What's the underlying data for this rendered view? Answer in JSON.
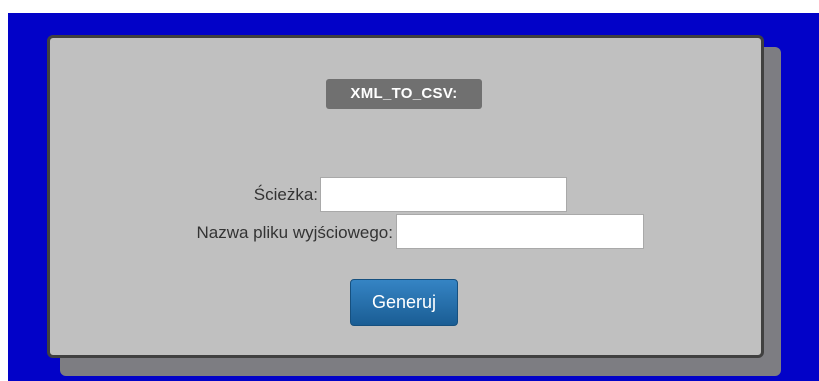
{
  "form": {
    "title": "XML_TO_CSV:",
    "path_label": "Ścieżka:",
    "path_value": "",
    "output_label": "Nazwa pliku wyjściowego:",
    "output_value": "",
    "submit_label": "Generuj"
  },
  "colors": {
    "page_background": "#0202c8",
    "panel_background": "#c0c0c0",
    "panel_border": "#404040",
    "badge_background": "#707070",
    "button_background": "#2a70ab"
  }
}
